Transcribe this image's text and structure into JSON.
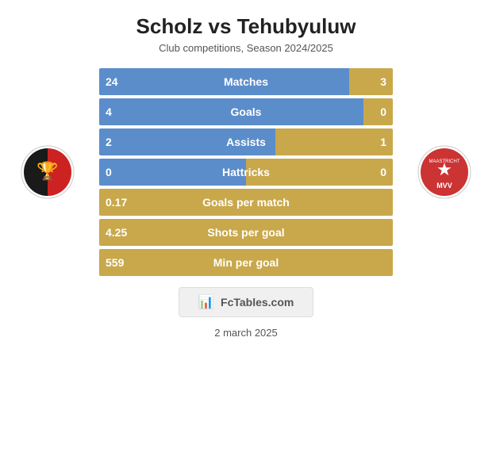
{
  "header": {
    "title": "Scholz vs Tehubyuluw",
    "subtitle": "Club competitions, Season 2024/2025"
  },
  "stats": [
    {
      "id": "matches",
      "label": "Matches",
      "left_val": "24",
      "right_val": "3",
      "fill_pct": 85
    },
    {
      "id": "goals",
      "label": "Goals",
      "left_val": "4",
      "right_val": "0",
      "fill_pct": 90
    },
    {
      "id": "assists",
      "label": "Assists",
      "left_val": "2",
      "right_val": "1",
      "fill_pct": 60
    },
    {
      "id": "hattricks",
      "label": "Hattricks",
      "left_val": "0",
      "right_val": "0",
      "fill_pct": 50
    }
  ],
  "single_stats": [
    {
      "id": "goals_per_match",
      "label": "Goals per match",
      "val": "0.17"
    },
    {
      "id": "shots_per_goal",
      "label": "Shots per goal",
      "val": "4.25"
    },
    {
      "id": "min_per_goal",
      "label": "Min per goal",
      "val": "559"
    }
  ],
  "watermark": {
    "label": "FcTables.com"
  },
  "date": {
    "label": "2 march 2025"
  }
}
